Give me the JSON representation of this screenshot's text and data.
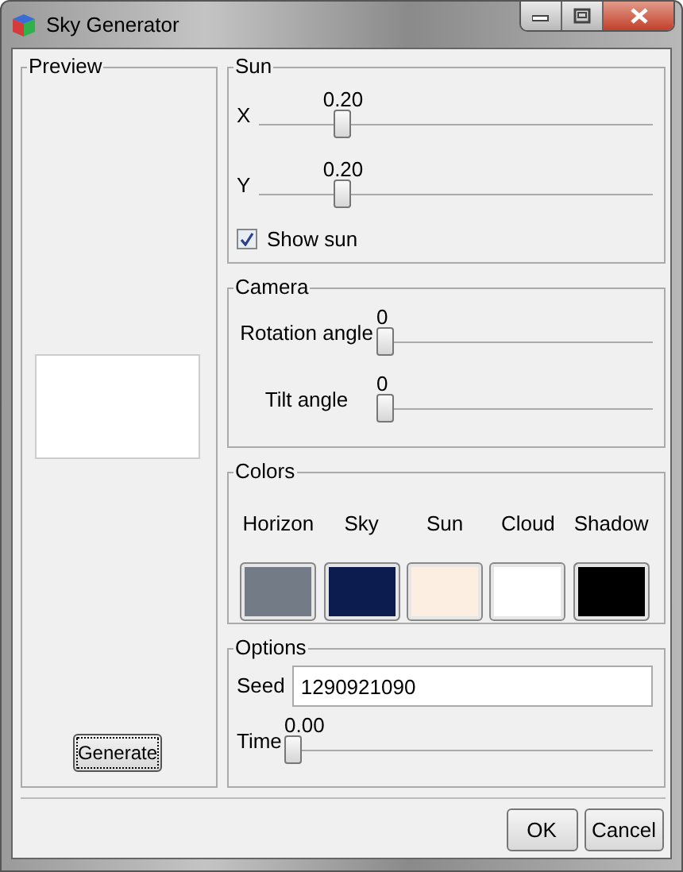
{
  "window": {
    "title": "Sky Generator"
  },
  "preview": {
    "title": "Preview",
    "button": "Generate"
  },
  "sun": {
    "title": "Sun",
    "sliders": [
      {
        "label": "X",
        "reading": "0.20",
        "level": 0.2
      },
      {
        "label": "Y",
        "reading": "0.20",
        "level": 0.2
      }
    ],
    "checkbox": {
      "label": "Show sun",
      "checked": true
    }
  },
  "camera": {
    "title": "Camera",
    "sliders": [
      {
        "label": "Rotation angle",
        "reading": "0",
        "level": 0
      },
      {
        "label": "Tilt angle",
        "reading": "0",
        "level": 0
      }
    ]
  },
  "colors": {
    "title": "Colors",
    "swatches": [
      {
        "label": "Horizon",
        "color": "#737b86"
      },
      {
        "label": "Sky",
        "color": "#0c1c4e"
      },
      {
        "label": "Sun",
        "color": "#fdeee2"
      },
      {
        "label": "Cloud",
        "color": "#ffffff"
      },
      {
        "label": "Shadow",
        "color": "#000000"
      }
    ]
  },
  "options": {
    "title": "Options",
    "seed": {
      "label": "Seed",
      "value": "1290921090"
    },
    "slider": {
      "label": "Time",
      "reading": "0.00",
      "level": 0
    }
  },
  "buttons": [
    "OK",
    "Cancel"
  ]
}
